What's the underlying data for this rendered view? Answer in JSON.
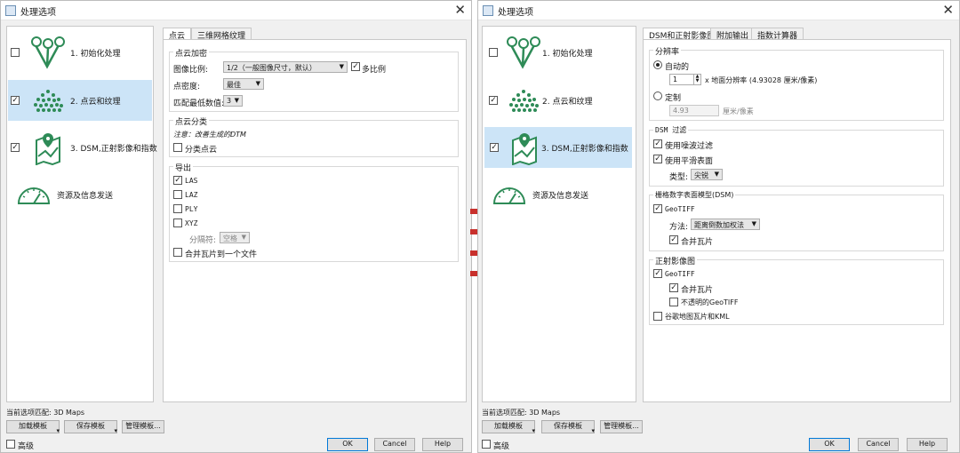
{
  "dialogs": [
    {
      "title": "处理选项",
      "steps": [
        {
          "label": "1. 初始化处理",
          "checked": false,
          "selected": false,
          "icon": "tripod-icon"
        },
        {
          "label": "2. 点云和纹理",
          "checked": true,
          "selected": true,
          "icon": "point-cloud-icon"
        },
        {
          "label": "3. DSM,正射影像和指数",
          "checked": true,
          "selected": false,
          "icon": "map-pin-icon"
        },
        {
          "label": "资源及信息发送",
          "checked": null,
          "selected": false,
          "icon": "gauge-icon"
        }
      ],
      "tabs": [
        "点云",
        "三维网格纹理"
      ],
      "point_cloud": {
        "densify_title": "点云加密",
        "image_scale_label": "图像比例:",
        "image_scale_value": "1/2（一般图像尺寸，默认）",
        "multiscale_label": "多比例",
        "multiscale_checked": true,
        "density_label": "点密度:",
        "density_value": "最佳",
        "min_match_label": "匹配最低数值:",
        "min_match_value": "3",
        "classify_title": "点云分类",
        "classify_note": "注意：改善生成的DTM",
        "classify_label": "分类点云",
        "classify_checked": false,
        "export_title": "导出",
        "formats": [
          {
            "label": "LAS",
            "checked": true
          },
          {
            "label": "LAZ",
            "checked": false
          },
          {
            "label": "PLY",
            "checked": false
          },
          {
            "label": "XYZ",
            "checked": false
          }
        ],
        "delimiter_label": "分隔符:",
        "delimiter_value": "空格",
        "merge_label": "合并瓦片到一个文件",
        "merge_checked": false
      },
      "footer": {
        "template_text": "当前选项匹配:  3D Maps",
        "load_template": "加载模板",
        "save_template": "保存模板",
        "manage_template": "管理模板...",
        "advanced_label": "高级",
        "ok": "OK",
        "cancel": "Cancel",
        "help": "Help"
      }
    },
    {
      "title": "处理选项",
      "steps": [
        {
          "label": "1. 初始化处理",
          "checked": false,
          "selected": false,
          "icon": "tripod-icon"
        },
        {
          "label": "2. 点云和纹理",
          "checked": true,
          "selected": false,
          "icon": "point-cloud-icon"
        },
        {
          "label": "3. DSM,正射影像和指数",
          "checked": true,
          "selected": true,
          "icon": "map-pin-icon"
        },
        {
          "label": "资源及信息发送",
          "checked": null,
          "selected": false,
          "icon": "gauge-icon"
        }
      ],
      "tabs": [
        "DSM和正射影像图",
        "附加输出",
        "指数计算器"
      ],
      "dsm": {
        "resolution_title": "分辨率",
        "auto_label": "自动的",
        "auto_selected": true,
        "gsd_multiplier": "1",
        "gsd_text": "x 地面分辨率 (4.93028 厘米/像素)",
        "custom_label": "定制",
        "custom_selected": false,
        "custom_value": "4.93",
        "custom_unit": "厘米/像素",
        "filter_title": "DSM 过滤",
        "noise_label": "使用噪波过滤",
        "noise_checked": true,
        "smooth_label": "使用平滑表面",
        "smooth_checked": true,
        "type_label": "类型:",
        "type_value": "尖锐",
        "raster_title": "栅格数字表面模型(DSM)",
        "raster_geotiff": "GeoTIFF",
        "raster_geotiff_checked": true,
        "method_label": "方法:",
        "method_value": "距离倒数加权法",
        "raster_merge": "合并瓦片",
        "raster_merge_checked": true,
        "ortho_title": "正射影像图",
        "ortho_geotiff": "GeoTIFF",
        "ortho_geotiff_checked": true,
        "ortho_merge": "合并瓦片",
        "ortho_merge_checked": true,
        "opaque_label": "不透明的GeoTIFF",
        "opaque_checked": false,
        "kml_label": "谷歌地图瓦片和KML",
        "kml_checked": false
      },
      "footer": {
        "template_text": "当前选项匹配:  3D Maps",
        "load_template": "加载模板",
        "save_template": "保存模板",
        "manage_template": "管理模板...",
        "advanced_label": "高级",
        "ok": "OK",
        "cancel": "Cancel",
        "help": "Help"
      }
    }
  ]
}
